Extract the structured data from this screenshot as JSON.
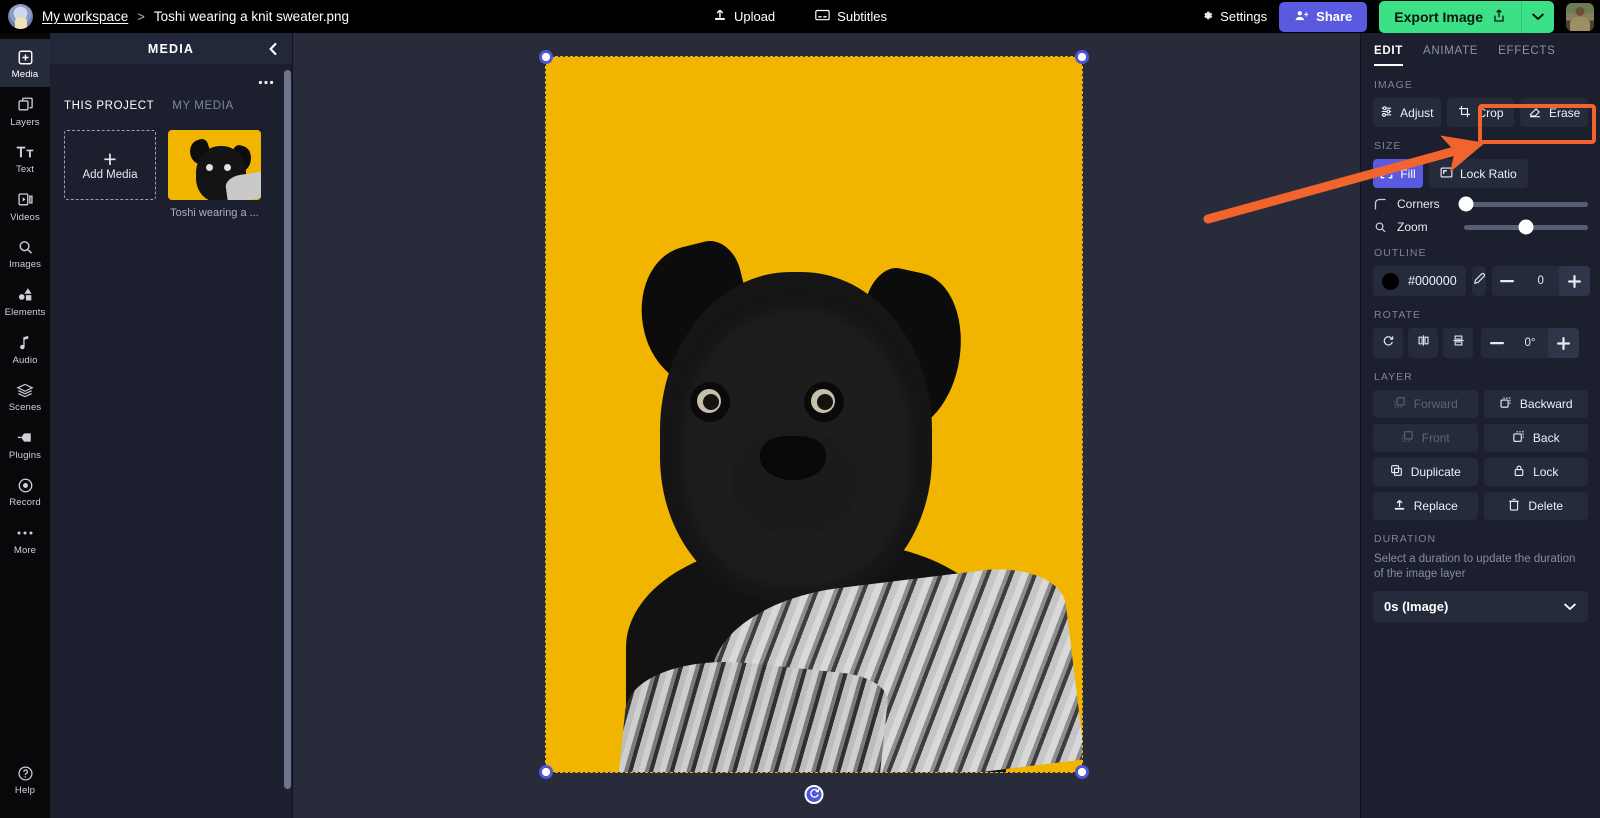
{
  "topbar": {
    "workspace_link": "My workspace",
    "separator": ">",
    "file_name": "Toshi wearing a knit sweater.png",
    "upload_label": "Upload",
    "subtitles_label": "Subtitles",
    "settings_label": "Settings",
    "share_label": "Share",
    "export_label": "Export Image",
    "workspace_avatar": "cat-avatar-icon",
    "user_avatar": "user-avatar-icon",
    "upload_icon": "upload-icon",
    "subtitles_icon": "subtitles-icon",
    "settings_icon": "gear-icon",
    "share_icon": "add-person-icon",
    "export_icon": "share-out-icon",
    "export_caret_icon": "chevron-down-icon"
  },
  "rail": {
    "items": [
      {
        "label": "Media",
        "icon": "media-plus-icon",
        "active": true
      },
      {
        "label": "Layers",
        "icon": "layers-icon",
        "active": false
      },
      {
        "label": "Text",
        "icon": "text-icon",
        "active": false
      },
      {
        "label": "Videos",
        "icon": "video-icon",
        "active": false
      },
      {
        "label": "Images",
        "icon": "search-icon",
        "active": false
      },
      {
        "label": "Elements",
        "icon": "shapes-icon",
        "active": false
      },
      {
        "label": "Audio",
        "icon": "music-note-icon",
        "active": false
      },
      {
        "label": "Scenes",
        "icon": "stack-icon",
        "active": false
      },
      {
        "label": "Plugins",
        "icon": "plug-icon",
        "active": false
      },
      {
        "label": "Record",
        "icon": "record-icon",
        "active": false
      },
      {
        "label": "More",
        "icon": "ellipsis-icon",
        "active": false
      }
    ],
    "help_label": "Help",
    "help_icon": "question-circle-icon"
  },
  "media_panel": {
    "title": "MEDIA",
    "collapse_icon": "chevron-left-icon",
    "more_icon": "ellipsis-icon",
    "tabs": [
      {
        "label": "THIS PROJECT",
        "active": true
      },
      {
        "label": "MY MEDIA",
        "active": false
      }
    ],
    "add_media_label": "Add Media",
    "add_media_icon": "plus-icon",
    "items": [
      {
        "caption": "Toshi wearing a ...",
        "thumbnail": "pug-on-yellow-thumbnail"
      }
    ]
  },
  "canvas": {
    "background_color": "#272b3a",
    "image_background": "#f1b500",
    "selection_color": "#4d56d6",
    "selection_border_color": "#e8ae1c",
    "rotate_handle_icon": "rotate-icon",
    "handles": [
      "top-left",
      "top-right",
      "bottom-left",
      "bottom-right"
    ]
  },
  "right_panel": {
    "tabs": [
      {
        "label": "EDIT",
        "active": true
      },
      {
        "label": "ANIMATE",
        "active": false
      },
      {
        "label": "EFFECTS",
        "active": false
      }
    ],
    "image": {
      "section_label": "IMAGE",
      "buttons": [
        {
          "label": "Adjust",
          "icon": "sliders-icon",
          "active": false
        },
        {
          "label": "Crop",
          "icon": "crop-icon",
          "active": false
        },
        {
          "label": "Erase",
          "icon": "eraser-icon",
          "active": false,
          "highlighted": true
        }
      ]
    },
    "size": {
      "section_label": "SIZE",
      "fill_label": "Fill",
      "fill_icon": "expand-icon",
      "fill_active": true,
      "lock_ratio_label": "Lock Ratio",
      "lock_ratio_icon": "aspect-ratio-icon",
      "corners_label": "Corners",
      "corners_icon": "corner-radius-icon",
      "corners_value_pct": 2,
      "zoom_label": "Zoom",
      "zoom_icon": "magnifier-icon",
      "zoom_value_pct": 50
    },
    "outline": {
      "section_label": "OUTLINE",
      "color_hex": "#000000",
      "eyedropper_icon": "eyedropper-icon",
      "minus_icon": "minus-icon",
      "width_value": "0",
      "plus_icon": "plus-icon"
    },
    "rotate": {
      "section_label": "ROTATE",
      "buttons": [
        {
          "icon": "rotate-ccw-icon"
        },
        {
          "icon": "flip-horizontal-icon"
        },
        {
          "icon": "flip-vertical-icon"
        }
      ],
      "minus_icon": "minus-icon",
      "angle_value": "0°",
      "plus_icon": "plus-icon"
    },
    "layer": {
      "section_label": "LAYER",
      "buttons": [
        {
          "label": "Forward",
          "icon": "bring-forward-icon",
          "disabled": true
        },
        {
          "label": "Backward",
          "icon": "send-backward-icon",
          "disabled": false
        },
        {
          "label": "Front",
          "icon": "bring-front-icon",
          "disabled": true
        },
        {
          "label": "Back",
          "icon": "send-back-icon",
          "disabled": false
        },
        {
          "label": "Duplicate",
          "icon": "duplicate-icon",
          "disabled": false
        },
        {
          "label": "Lock",
          "icon": "lock-icon",
          "disabled": false
        },
        {
          "label": "Replace",
          "icon": "upload-icon",
          "disabled": false
        },
        {
          "label": "Delete",
          "icon": "trash-icon",
          "disabled": false
        }
      ]
    },
    "duration": {
      "section_label": "DURATION",
      "description": "Select a duration to update the duration of the image layer",
      "selected_value": "0s (Image)",
      "caret_icon": "chevron-down-icon"
    }
  },
  "annotations": {
    "arrow_color": "#f2642e",
    "highlight_target": "Erase",
    "highlight_color": "#f2642e"
  }
}
